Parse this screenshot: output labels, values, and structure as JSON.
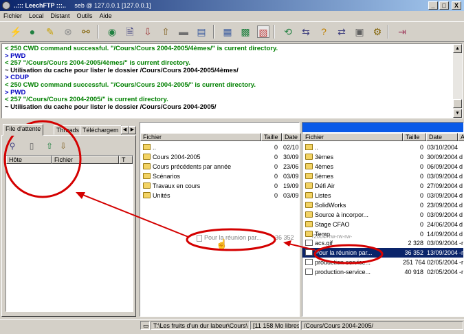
{
  "window": {
    "title": "..::: LeechFTP :::..",
    "subtitle": "seb @ 127.0.0.1 [127.0.0.1]",
    "controls": [
      "_",
      "□",
      "X"
    ]
  },
  "menu": [
    "Fichier",
    "Local",
    "Distant",
    "Outils",
    "Aide"
  ],
  "toolbar": {
    "icons": [
      "connect-icon",
      "globe-icon",
      "edit-icon",
      "stop-icon",
      "disconnect-icon",
      "refresh-icon",
      "view-icon",
      "download-icon",
      "upload-icon",
      "new-folder-icon",
      "properties-icon",
      "text-icon",
      "image-icon",
      "file-icon",
      "sync-icon",
      "transfer-icon",
      "help-icon",
      "folder-transfer-icon",
      "queue-icon",
      "settings-icon",
      "exit-icon"
    ]
  },
  "log": [
    {
      "text": "< 250 CWD command successful. \"/Cours/Cours 2004-2005/4èmes/\" is current directory.",
      "color": "g"
    },
    {
      "text": "> PWD",
      "color": "b"
    },
    {
      "text": "< 257 \"/Cours/Cours 2004-2005/4èmes/\" is current directory.",
      "color": "g"
    },
    {
      "text": "~ Utilisation du cache pour lister le dossier /Cours/Cours 2004-2005/4èmes/",
      "color": "k"
    },
    {
      "text": "> CDUP",
      "color": "b"
    },
    {
      "text": "< 250 CWD command successful. \"/Cours/Cours 2004-2005/\" is current directory.",
      "color": "g"
    },
    {
      "text": "> PWD",
      "color": "b"
    },
    {
      "text": "< 257 \"/Cours/Cours 2004-2005/\" is current directory.",
      "color": "g"
    },
    {
      "text": "~ Utilisation du cache pour lister le dossier /Cours/Cours 2004-2005/",
      "color": "k"
    }
  ],
  "queue": {
    "tabs": [
      "File d'attente",
      "Threads",
      "Téléchargem"
    ],
    "columns": [
      "Hôte",
      "Fichier",
      "T"
    ]
  },
  "local": {
    "columns": [
      "Fichier",
      "Taille",
      "Date"
    ],
    "rows": [
      {
        "name": "..",
        "size": "0",
        "date": "02/10",
        "type": "up"
      },
      {
        "name": "Cours 2004-2005",
        "size": "0",
        "date": "30/09",
        "type": "folder"
      },
      {
        "name": "Cours précédents par année",
        "size": "0",
        "date": "23/06",
        "type": "folder"
      },
      {
        "name": "Scénarios",
        "size": "0",
        "date": "03/09",
        "type": "folder"
      },
      {
        "name": "Travaux en cours",
        "size": "0",
        "date": "19/09",
        "type": "folder"
      },
      {
        "name": "Unités",
        "size": "0",
        "date": "03/09",
        "type": "folder"
      }
    ]
  },
  "remote": {
    "columns": [
      "Fichier",
      "Taille",
      "Date",
      "A"
    ],
    "rows": [
      {
        "name": "..",
        "size": "0",
        "date": "03/10/2004",
        "extra": "",
        "type": "up"
      },
      {
        "name": "3èmes",
        "size": "0",
        "date": "30/09/2004",
        "extra": "d",
        "type": "folder"
      },
      {
        "name": "4èmes",
        "size": "0",
        "date": "06/09/2004",
        "extra": "d",
        "type": "folder"
      },
      {
        "name": "5èmes",
        "size": "0",
        "date": "03/09/2004",
        "extra": "d",
        "type": "folder"
      },
      {
        "name": "Défi Air",
        "size": "0",
        "date": "27/09/2004",
        "extra": "d",
        "type": "folder"
      },
      {
        "name": "Listes",
        "size": "0",
        "date": "03/09/2004",
        "extra": "d",
        "type": "folder"
      },
      {
        "name": "SolidWorks",
        "size": "0",
        "date": "23/09/2004",
        "extra": "d",
        "type": "folder"
      },
      {
        "name": "Source à incorpor...",
        "size": "0",
        "date": "03/09/2004",
        "extra": "d",
        "type": "folder"
      },
      {
        "name": "Stage CFAO",
        "size": "0",
        "date": "24/06/2004",
        "extra": "d",
        "type": "folder"
      },
      {
        "name": "Temp",
        "size": "0",
        "date": "14/09/2004",
        "extra": "d",
        "type": "folder"
      },
      {
        "name": "acs.gif",
        "size": "2 328",
        "date": "03/09/2004",
        "extra": "-r",
        "type": "file"
      },
      {
        "name": "Pour la réunion par...",
        "size": "36 352",
        "date": "13/09/2004",
        "extra": "-r",
        "type": "file",
        "selected": true
      },
      {
        "name": "production-service...",
        "size": "251 764",
        "date": "02/05/2004",
        "extra": "-r",
        "type": "file"
      },
      {
        "name": "production-service...",
        "size": "40 918",
        "date": "02/05/2004",
        "extra": "-r",
        "type": "file"
      }
    ]
  },
  "drag": {
    "name": "Pour la réunion par...",
    "size": "36 352",
    "ghost": "/2004 -rw-rw-rw-"
  },
  "status": {
    "local_path": "T:\\Les fruits d'un dur labeur\\Cours\\",
    "free": "[11 158 Mo libres]",
    "remote_path": "/Cours/Cours 2004-2005/"
  },
  "colors": {
    "annotation": "#d40000",
    "selection": "#0a246a",
    "panel_header": "#0a5ae8"
  }
}
